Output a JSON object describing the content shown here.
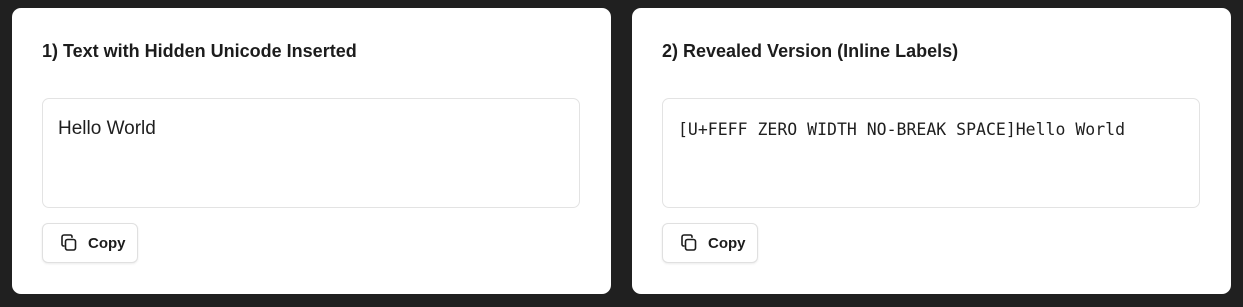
{
  "panels": [
    {
      "title": "1) Text with Hidden Unicode Inserted",
      "content": "Hello World",
      "copy_label": "Copy"
    },
    {
      "title": "2) Revealed Version (Inline Labels)",
      "content": "[U+FEFF ZERO WIDTH NO-BREAK SPACE]Hello World",
      "copy_label": "Copy"
    }
  ],
  "icons": {
    "copy": "copy-icon"
  }
}
